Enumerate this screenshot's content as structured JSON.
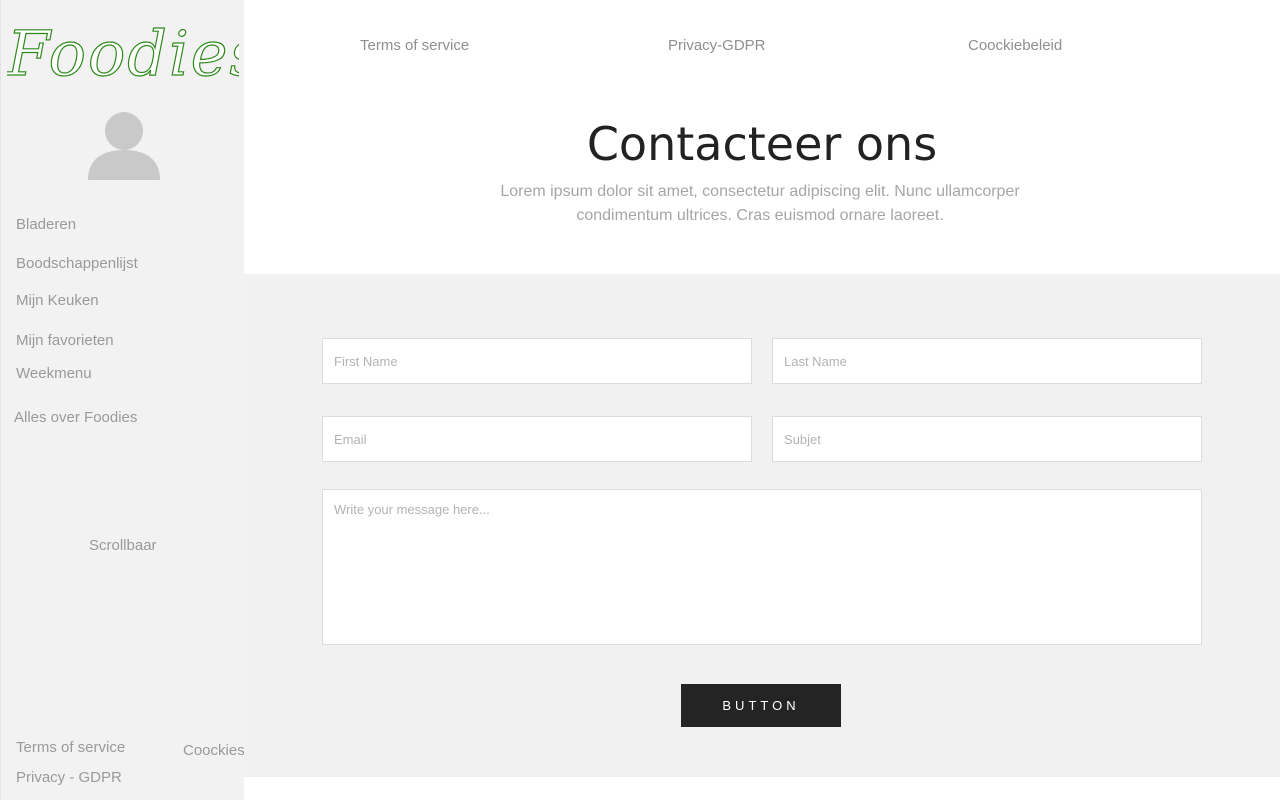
{
  "sidebar": {
    "logo_text": "Foodies",
    "nav_items": [
      {
        "label": "Bladeren"
      },
      {
        "label": "Boodschappenlijst"
      },
      {
        "label": "Mijn Keuken"
      },
      {
        "label": "Mijn favorieten"
      },
      {
        "label": "Weekmenu"
      },
      {
        "label": "Alles over Foodies"
      }
    ],
    "scroll_label": "Scrollbaar",
    "footer": {
      "terms": "Terms of service",
      "privacy": "Privacy - GDPR",
      "cookies": "Coockies"
    }
  },
  "top_links": {
    "terms": "Terms of service",
    "privacy": "Privacy-GDPR",
    "cookie_policy": "Coockiebeleid"
  },
  "header": {
    "title": "Contacteer ons",
    "subtitle": "Lorem ipsum dolor sit amet, consectetur adipiscing elit. Nunc ullamcorper condimentum ultrices. Cras euismod ornare laoreet."
  },
  "form": {
    "first_name_placeholder": "First Name",
    "last_name_placeholder": "Last Name",
    "email_placeholder": "Email",
    "subject_placeholder": "Subjet",
    "message_placeholder": "Write your message here...",
    "button_label": "BUTTON"
  },
  "colors": {
    "logo_green": "#2f8a1c",
    "sidebar_bg": "#f2f2f2",
    "form_bg": "#f1f1f1",
    "button_bg": "#242424"
  }
}
